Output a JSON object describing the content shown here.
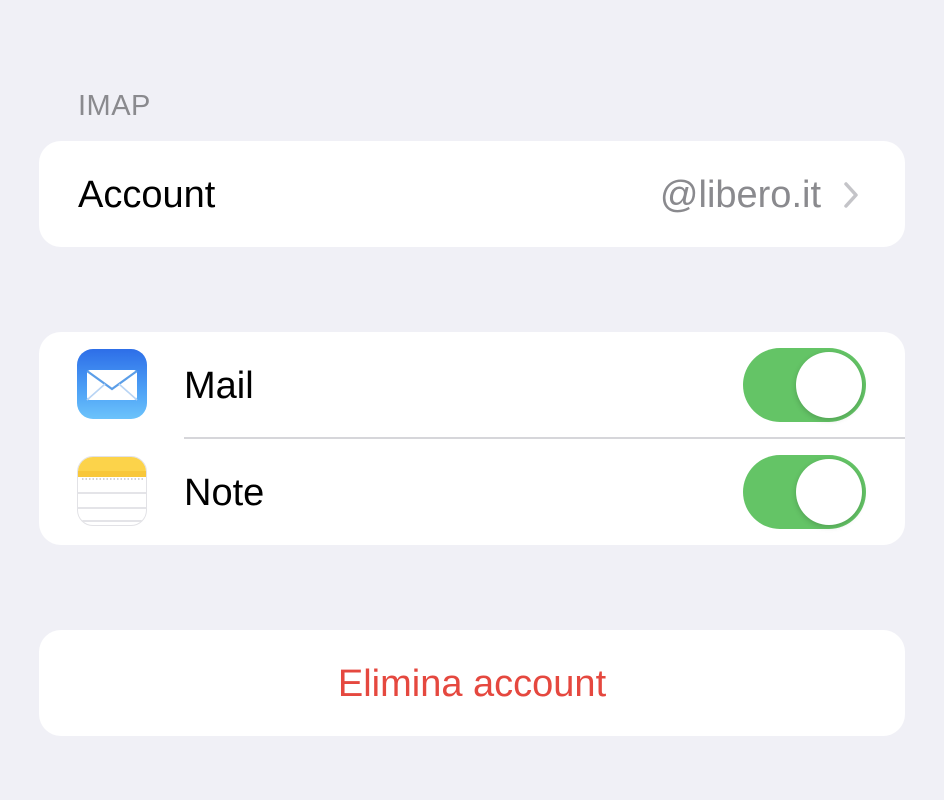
{
  "section": {
    "header": "IMAP"
  },
  "account": {
    "label": "Account",
    "value": "@libero.it",
    "chevron_icon": "chevron-right-icon"
  },
  "apps": [
    {
      "label": "Mail",
      "icon": "mail-app-icon",
      "enabled": true
    },
    {
      "label": "Note",
      "icon": "notes-app-icon",
      "enabled": true
    }
  ],
  "actions": {
    "delete_label": "Elimina account"
  },
  "colors": {
    "background": "#f0f0f6",
    "toggle_on": "#64c466",
    "destructive": "#e5483f",
    "secondary_text": "#8a8a8e"
  }
}
